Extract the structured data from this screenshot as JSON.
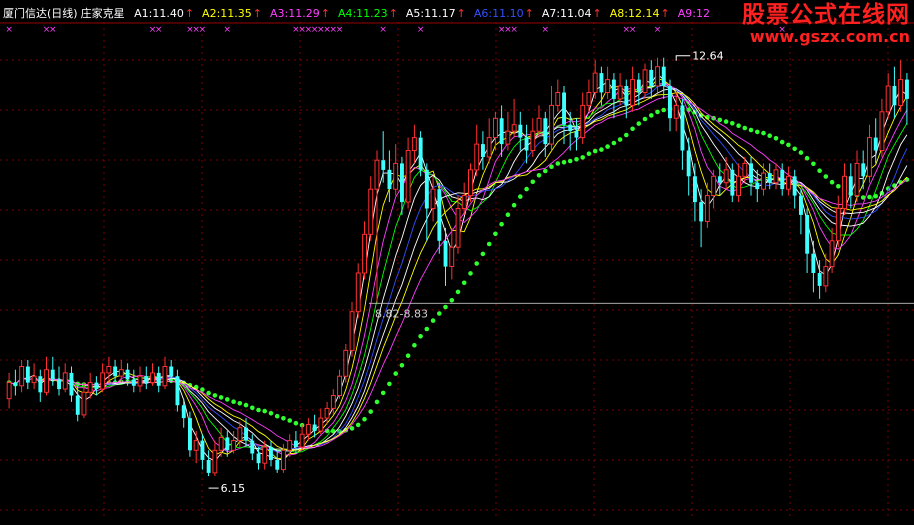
{
  "header": {
    "stock_name": "厦门信达",
    "period": "(日线)",
    "indicator": "庄家克星",
    "items": [
      {
        "label": "A1:11.40",
        "color": "#ffffff",
        "up": true
      },
      {
        "label": "A2:11.35",
        "color": "#ffff00",
        "up": true
      },
      {
        "label": "A3:11.29",
        "color": "#ff40ff",
        "up": true
      },
      {
        "label": "A4:11.23",
        "color": "#00ff00",
        "up": true
      },
      {
        "label": "A5:11.17",
        "color": "#ffffff",
        "up": true
      },
      {
        "label": "A6:11.10",
        "color": "#3050ff",
        "up": true
      },
      {
        "label": "A7:11.04",
        "color": "#ffffff",
        "up": true
      },
      {
        "label": "A8:12.14",
        "color": "#ffff00",
        "up": true
      },
      {
        "label": "A9:12",
        "color": "#ff40ff",
        "up": false
      }
    ],
    "arrow": "↑"
  },
  "watermark": {
    "line1": "股票公式在线网",
    "line2": "www.gszx.com.cn"
  },
  "chart_data": {
    "type": "candlestick",
    "y_range": [
      5.5,
      13.1
    ],
    "grid": true,
    "annotations": {
      "high": {
        "label": "12.64",
        "value": 12.64,
        "index": 107
      },
      "low": {
        "label": "6.15",
        "value": 6.15,
        "index": 32
      },
      "level": {
        "label": "8.82-8.83",
        "value": 8.83,
        "index": 59
      }
    },
    "colors": {
      "up": "#ff3030",
      "down": "#40ffff",
      "ma_colors": [
        "#ffffff",
        "#ffff00",
        "#ff40ff",
        "#00ff00",
        "#ffffff",
        "#3050ff",
        "#ffffff",
        "#ffff00",
        "#ff40ff"
      ],
      "dotted": "#30ff30",
      "marker": "#ff40ff"
    },
    "candles": [
      [
        7.35,
        7.6,
        7.75,
        7.2
      ],
      [
        7.6,
        7.55,
        7.8,
        7.4
      ],
      [
        7.55,
        7.85,
        7.95,
        7.45
      ],
      [
        7.85,
        7.6,
        7.95,
        7.5
      ],
      [
        7.6,
        7.7,
        7.9,
        7.5
      ],
      [
        7.7,
        7.45,
        7.8,
        7.3
      ],
      [
        7.45,
        7.8,
        8.0,
        7.4
      ],
      [
        7.8,
        7.65,
        8.0,
        7.55
      ],
      [
        7.65,
        7.5,
        7.85,
        7.4
      ],
      [
        7.5,
        7.75,
        7.9,
        7.45
      ],
      [
        7.75,
        7.4,
        7.85,
        7.3
      ],
      [
        7.4,
        7.1,
        7.55,
        7.0
      ],
      [
        7.1,
        7.45,
        7.6,
        7.05
      ],
      [
        7.45,
        7.6,
        7.75,
        7.35
      ],
      [
        7.6,
        7.5,
        7.7,
        7.4
      ],
      [
        7.5,
        7.75,
        7.9,
        7.45
      ],
      [
        7.75,
        7.85,
        8.0,
        7.6
      ],
      [
        7.85,
        7.7,
        7.95,
        7.6
      ],
      [
        7.7,
        7.8,
        7.95,
        7.6
      ],
      [
        7.8,
        7.65,
        7.9,
        7.55
      ],
      [
        7.65,
        7.55,
        7.8,
        7.45
      ],
      [
        7.55,
        7.7,
        7.85,
        7.45
      ],
      [
        7.7,
        7.6,
        7.85,
        7.5
      ],
      [
        7.6,
        7.75,
        7.9,
        7.55
      ],
      [
        7.75,
        7.55,
        7.85,
        7.45
      ],
      [
        7.55,
        7.85,
        8.0,
        7.5
      ],
      [
        7.85,
        7.7,
        7.95,
        7.6
      ],
      [
        7.7,
        7.25,
        7.8,
        7.15
      ],
      [
        7.25,
        7.05,
        7.35,
        6.9
      ],
      [
        7.05,
        6.55,
        7.15,
        6.45
      ],
      [
        6.55,
        6.7,
        6.85,
        6.35
      ],
      [
        6.7,
        6.4,
        6.8,
        6.25
      ],
      [
        6.4,
        6.2,
        6.55,
        6.15
      ],
      [
        6.2,
        6.55,
        6.7,
        6.15
      ],
      [
        6.55,
        6.75,
        6.9,
        6.45
      ],
      [
        6.75,
        6.55,
        6.85,
        6.45
      ],
      [
        6.55,
        6.7,
        6.85,
        6.5
      ],
      [
        6.7,
        6.9,
        7.0,
        6.6
      ],
      [
        6.9,
        6.7,
        7.05,
        6.6
      ],
      [
        6.7,
        6.5,
        6.8,
        6.4
      ],
      [
        6.5,
        6.35,
        6.6,
        6.25
      ],
      [
        6.35,
        6.6,
        6.7,
        6.25
      ],
      [
        6.6,
        6.4,
        6.7,
        6.3
      ],
      [
        6.4,
        6.25,
        6.55,
        6.2
      ],
      [
        6.25,
        6.55,
        6.65,
        6.2
      ],
      [
        6.55,
        6.7,
        6.8,
        6.45
      ],
      [
        6.7,
        6.6,
        6.85,
        6.5
      ],
      [
        6.6,
        6.8,
        6.95,
        6.55
      ],
      [
        6.8,
        6.95,
        7.05,
        6.7
      ],
      [
        6.95,
        6.85,
        7.1,
        6.75
      ],
      [
        6.85,
        7.05,
        7.2,
        6.8
      ],
      [
        7.05,
        7.2,
        7.3,
        6.95
      ],
      [
        7.2,
        7.4,
        7.5,
        7.1
      ],
      [
        7.4,
        7.7,
        7.8,
        7.35
      ],
      [
        7.7,
        8.1,
        8.2,
        7.6
      ],
      [
        8.1,
        8.7,
        8.85,
        8.0
      ],
      [
        8.7,
        9.3,
        9.45,
        8.6
      ],
      [
        9.3,
        9.9,
        10.1,
        9.2
      ],
      [
        9.9,
        10.6,
        10.8,
        9.8
      ],
      [
        10.6,
        11.05,
        11.2,
        8.83
      ],
      [
        11.05,
        10.9,
        11.5,
        10.7
      ],
      [
        10.9,
        10.6,
        11.2,
        10.4
      ],
      [
        10.6,
        11.0,
        11.3,
        10.5
      ],
      [
        11.0,
        10.4,
        11.1,
        10.2
      ],
      [
        10.4,
        11.2,
        11.4,
        10.3
      ],
      [
        11.2,
        11.4,
        11.6,
        11.0
      ],
      [
        11.4,
        10.9,
        11.5,
        10.8
      ],
      [
        10.9,
        10.3,
        11.0,
        9.8
      ],
      [
        10.3,
        10.6,
        10.8,
        10.1
      ],
      [
        10.6,
        9.8,
        10.7,
        9.6
      ],
      [
        9.8,
        9.4,
        10.0,
        9.1
      ],
      [
        9.4,
        9.7,
        10.0,
        9.2
      ],
      [
        9.7,
        10.3,
        10.5,
        9.6
      ],
      [
        10.3,
        10.5,
        10.7,
        10.2
      ],
      [
        10.5,
        10.9,
        11.0,
        10.4
      ],
      [
        10.9,
        11.3,
        11.6,
        10.8
      ],
      [
        11.3,
        11.1,
        11.5,
        10.9
      ],
      [
        11.1,
        11.4,
        11.7,
        11.0
      ],
      [
        11.4,
        11.7,
        11.8,
        11.2
      ],
      [
        11.7,
        11.3,
        11.9,
        11.1
      ],
      [
        11.3,
        11.5,
        11.8,
        11.2
      ],
      [
        11.5,
        11.6,
        12.0,
        11.4
      ],
      [
        11.6,
        11.4,
        11.8,
        11.2
      ],
      [
        11.4,
        11.2,
        11.6,
        11.0
      ],
      [
        11.2,
        11.5,
        11.7,
        11.1
      ],
      [
        11.5,
        11.7,
        11.9,
        11.4
      ],
      [
        11.7,
        11.3,
        11.8,
        11.1
      ],
      [
        11.3,
        11.9,
        12.2,
        11.2
      ],
      [
        11.9,
        12.1,
        12.3,
        11.8
      ],
      [
        12.1,
        11.6,
        12.2,
        11.3
      ],
      [
        11.6,
        11.5,
        11.8,
        11.2
      ],
      [
        11.5,
        11.4,
        11.7,
        11.2
      ],
      [
        11.4,
        11.9,
        12.1,
        11.3
      ],
      [
        11.9,
        12.1,
        12.3,
        11.8
      ],
      [
        12.1,
        12.4,
        12.6,
        12.0
      ],
      [
        12.4,
        12.1,
        12.5,
        11.9
      ],
      [
        12.1,
        12.3,
        12.5,
        12.0
      ],
      [
        12.3,
        12.0,
        12.4,
        11.7
      ],
      [
        12.0,
        12.2,
        12.4,
        11.9
      ],
      [
        12.2,
        11.9,
        12.3,
        11.7
      ],
      [
        11.9,
        12.3,
        12.5,
        11.8
      ],
      [
        12.3,
        12.1,
        12.4,
        11.9
      ],
      [
        12.1,
        12.45,
        12.55,
        12.0
      ],
      [
        12.45,
        12.2,
        12.6,
        12.0
      ],
      [
        12.2,
        12.5,
        12.64,
        12.1
      ],
      [
        12.5,
        12.2,
        12.64,
        12.0
      ],
      [
        12.2,
        11.7,
        12.3,
        11.5
      ],
      [
        11.7,
        11.9,
        12.1,
        11.5
      ],
      [
        11.9,
        11.2,
        12.0,
        10.9
      ],
      [
        11.2,
        10.8,
        11.4,
        10.5
      ],
      [
        10.8,
        10.4,
        11.0,
        10.1
      ],
      [
        10.4,
        10.1,
        10.6,
        9.7
      ],
      [
        10.1,
        10.5,
        10.7,
        10.0
      ],
      [
        10.5,
        10.8,
        10.9,
        10.3
      ],
      [
        10.8,
        10.7,
        11.0,
        10.5
      ],
      [
        10.7,
        10.9,
        11.1,
        10.6
      ],
      [
        10.9,
        10.5,
        11.0,
        10.4
      ],
      [
        10.5,
        10.8,
        11.0,
        10.4
      ],
      [
        10.8,
        11.0,
        11.1,
        10.7
      ],
      [
        11.0,
        10.7,
        11.1,
        10.5
      ],
      [
        10.7,
        10.6,
        10.9,
        10.4
      ],
      [
        10.6,
        10.85,
        11.0,
        10.5
      ],
      [
        10.85,
        10.7,
        11.0,
        10.6
      ],
      [
        10.7,
        10.9,
        11.0,
        10.6
      ],
      [
        10.9,
        10.6,
        11.0,
        10.5
      ],
      [
        10.6,
        10.8,
        10.95,
        10.5
      ],
      [
        10.8,
        10.5,
        10.9,
        10.3
      ],
      [
        10.5,
        10.2,
        10.6,
        9.9
      ],
      [
        10.2,
        9.6,
        10.3,
        9.3
      ],
      [
        9.6,
        9.3,
        9.8,
        9.0
      ],
      [
        9.3,
        9.1,
        9.5,
        8.9
      ],
      [
        9.1,
        9.4,
        9.6,
        9.0
      ],
      [
        9.4,
        9.8,
        10.0,
        9.3
      ],
      [
        9.8,
        10.3,
        10.5,
        9.7
      ],
      [
        10.3,
        10.8,
        11.0,
        10.2
      ],
      [
        10.8,
        10.5,
        11.0,
        10.3
      ],
      [
        10.5,
        11.0,
        11.2,
        10.4
      ],
      [
        11.0,
        10.8,
        11.2,
        10.6
      ],
      [
        10.8,
        11.4,
        11.6,
        10.7
      ],
      [
        11.4,
        11.2,
        11.7,
        11.0
      ],
      [
        11.2,
        11.8,
        12.0,
        11.1
      ],
      [
        11.8,
        12.2,
        12.4,
        11.7
      ],
      [
        12.2,
        11.9,
        12.5,
        11.7
      ],
      [
        11.9,
        12.3,
        12.6,
        11.8
      ],
      [
        12.3,
        12.0,
        12.4,
        11.6
      ]
    ],
    "ma_periods": [
      3,
      5,
      7,
      9,
      11,
      13,
      15,
      17,
      20
    ],
    "dotted_period": 30,
    "cross_markers_rows": [
      0,
      6,
      7,
      23,
      24,
      29,
      30,
      31,
      35,
      46,
      47,
      48,
      49,
      50,
      51,
      52,
      53,
      60,
      66,
      79,
      80,
      81,
      86,
      99,
      100,
      104,
      124
    ]
  }
}
